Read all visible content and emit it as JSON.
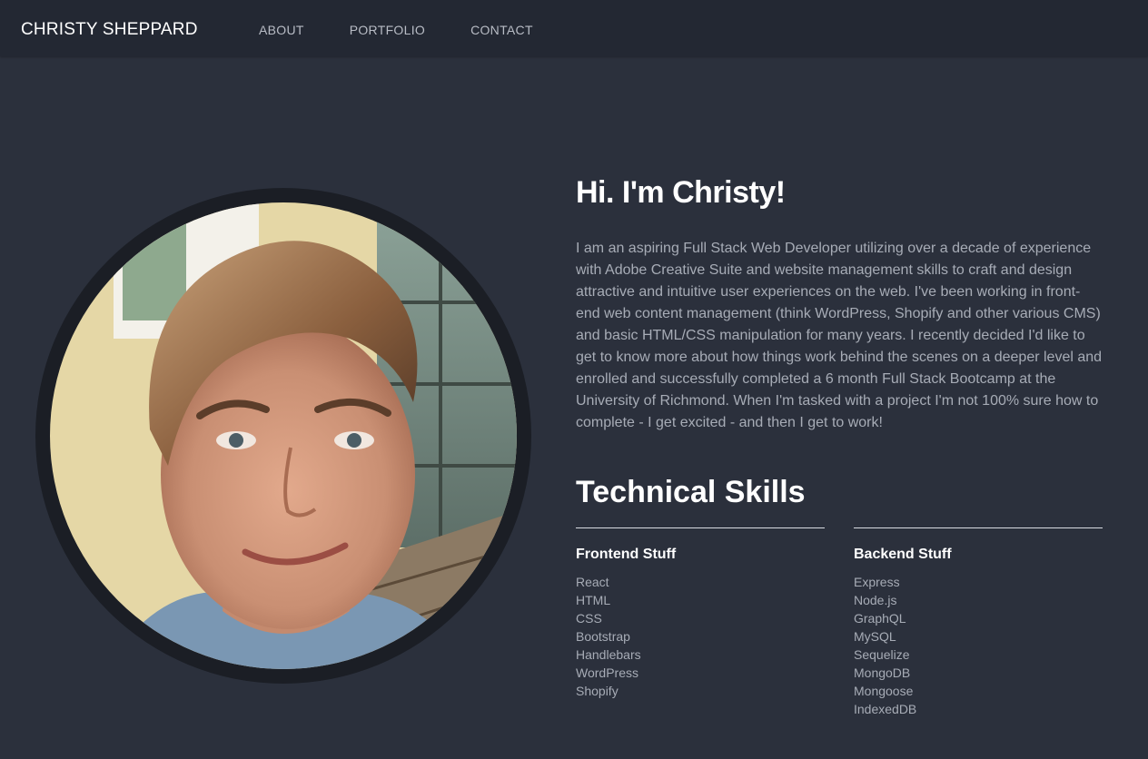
{
  "nav": {
    "brand": "CHRISTY SHEPPARD",
    "links": [
      "ABOUT",
      "PORTFOLIO",
      "CONTACT"
    ]
  },
  "hero": {
    "title": "Hi. I'm Christy!",
    "bio": "I am an aspiring Full Stack Web Developer utilizing over a decade of experience with Adobe Creative Suite and website management skills to craft and design attractive and intuitive user experiences on the web. I've been working in front-end web content management (think WordPress, Shopify and other various CMS) and basic HTML/CSS manipulation for many years. I recently decided I'd like to get to know more about how things work behind the scenes on a deeper level and enrolled and successfully completed a 6 month Full Stack Bootcamp at the University of Richmond. When I'm tasked with a project I'm not 100% sure how to complete - I get excited - and then I get to work!"
  },
  "skills": {
    "title": "Technical Skills",
    "frontend": {
      "title": "Frontend Stuff",
      "items": [
        "React",
        "HTML",
        "CSS",
        "Bootstrap",
        "Handlebars",
        "WordPress",
        "Shopify"
      ]
    },
    "backend": {
      "title": "Backend Stuff",
      "items": [
        "Express",
        "Node.js",
        "GraphQL",
        "MySQL",
        "Sequelize",
        "MongoDB",
        "Mongoose",
        "IndexedDB"
      ]
    }
  },
  "colors": {
    "page_bg": "#2b303c",
    "nav_bg": "#232833",
    "text_muted": "#a7acb6",
    "heading": "#ffffff"
  }
}
